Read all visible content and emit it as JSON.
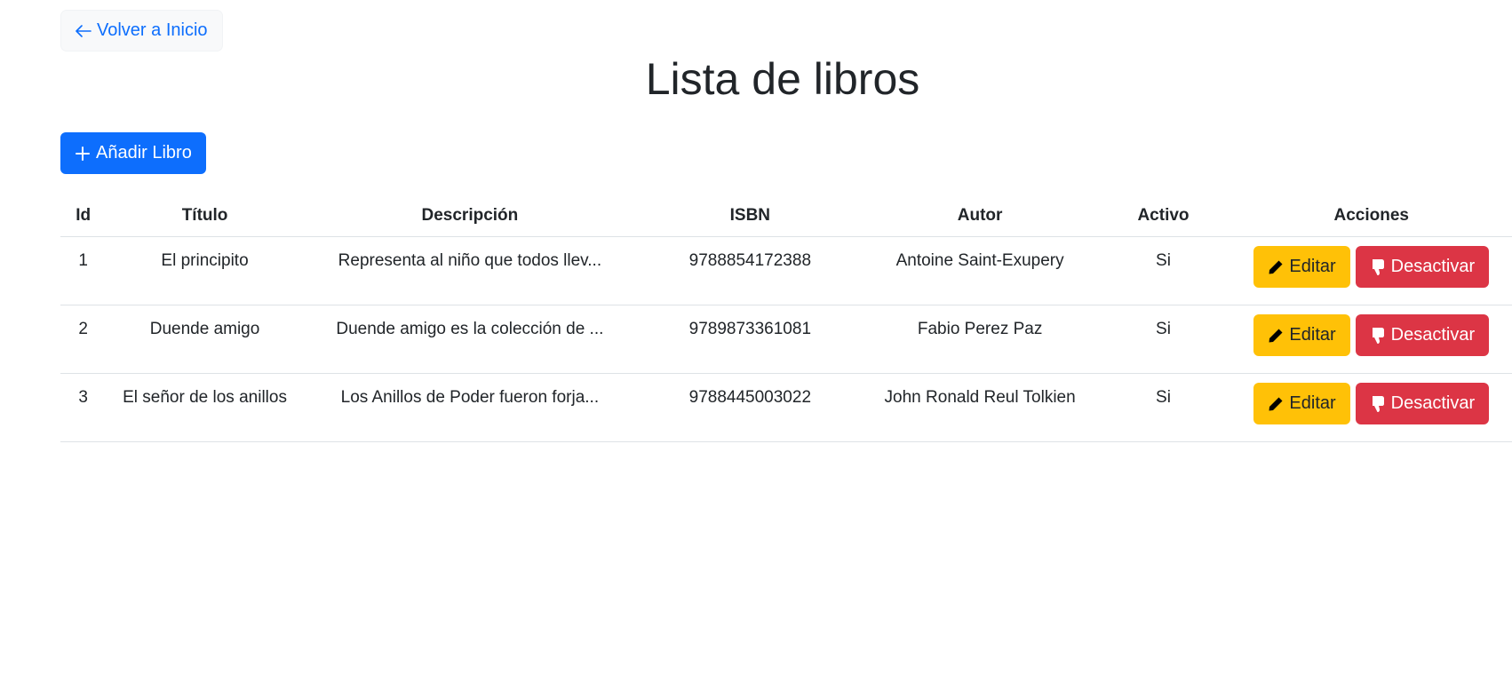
{
  "back_link": {
    "label": "Volver a Inicio",
    "icon": "arrow-left-icon"
  },
  "page_title": "Lista de libros",
  "add_button": {
    "label": "Añadir Libro",
    "icon": "plus-icon"
  },
  "table": {
    "headers": [
      "Id",
      "Título",
      "Descripción",
      "ISBN",
      "Autor",
      "Activo",
      "Acciones"
    ],
    "rows": [
      {
        "id": "1",
        "titulo": "El principito",
        "descripcion": "Representa al niño que todos llev...",
        "isbn": "9788854172388",
        "autor": "Antoine Saint-Exupery",
        "activo": "Si",
        "edit_label": "Editar",
        "deactivate_label": "Desactivar"
      },
      {
        "id": "2",
        "titulo": "Duende amigo",
        "descripcion": "Duende amigo es la colección de ...",
        "isbn": "9789873361081",
        "autor": "Fabio Perez Paz",
        "activo": "Si",
        "edit_label": "Editar",
        "deactivate_label": "Desactivar"
      },
      {
        "id": "3",
        "titulo": "El señor de los anillos",
        "descripcion": "Los Anillos de Poder fueron forja...",
        "isbn": "9788445003022",
        "autor": "John Ronald Reul Tolkien",
        "activo": "Si",
        "edit_label": "Editar",
        "deactivate_label": "Desactivar"
      }
    ]
  },
  "colors": {
    "primary": "#0d6efd",
    "warning": "#ffc107",
    "danger": "#dc3545",
    "light": "#f8f9fa"
  }
}
